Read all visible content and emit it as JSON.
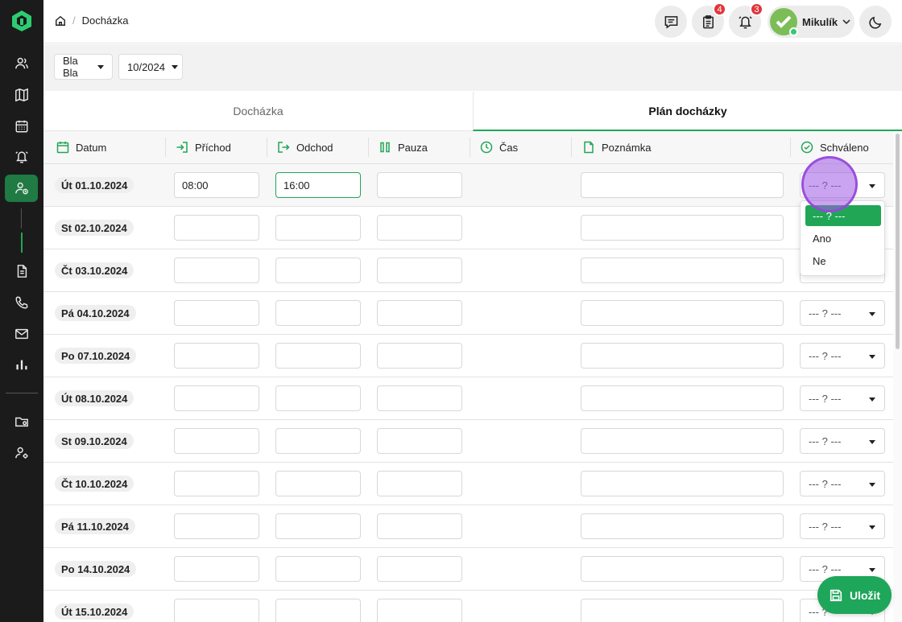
{
  "breadcrumb": {
    "current": "Docházka"
  },
  "topbar": {
    "notes_badge": "4",
    "alerts_badge": "3",
    "user_name": "Mikulík"
  },
  "filters": {
    "person": "Bla Bla",
    "period": "10/2024"
  },
  "tabs": [
    {
      "label": "Docházka",
      "active": false
    },
    {
      "label": "Plán docházky",
      "active": true
    }
  ],
  "columns": {
    "date": "Datum",
    "arrival": "Příchod",
    "departure": "Odchod",
    "pause": "Pauza",
    "time": "Čas",
    "note": "Poznámka",
    "approved": "Schváleno"
  },
  "rows": [
    {
      "date": "Út 01.10.2024",
      "arrival": "08:00",
      "departure": "16:00",
      "pause": "",
      "approved": "--- ? ---"
    },
    {
      "date": "St 02.10.2024",
      "arrival": "",
      "departure": "",
      "pause": "",
      "approved": "--- ? ---"
    },
    {
      "date": "Čt 03.10.2024",
      "arrival": "",
      "departure": "",
      "pause": "",
      "approved": "--- ? ---"
    },
    {
      "date": "Pá 04.10.2024",
      "arrival": "",
      "departure": "",
      "pause": "",
      "approved": "--- ? ---"
    },
    {
      "date": "Po 07.10.2024",
      "arrival": "",
      "departure": "",
      "pause": "",
      "approved": "--- ? ---"
    },
    {
      "date": "Út 08.10.2024",
      "arrival": "",
      "departure": "",
      "pause": "",
      "approved": "--- ? ---"
    },
    {
      "date": "St 09.10.2024",
      "arrival": "",
      "departure": "",
      "pause": "",
      "approved": "--- ? ---"
    },
    {
      "date": "Čt 10.10.2024",
      "arrival": "",
      "departure": "",
      "pause": "",
      "approved": "--- ? ---"
    },
    {
      "date": "Pá 11.10.2024",
      "arrival": "",
      "departure": "",
      "pause": "",
      "approved": "--- ? ---"
    },
    {
      "date": "Po 14.10.2024",
      "arrival": "",
      "departure": "",
      "pause": "",
      "approved": "--- ? ---"
    },
    {
      "date": "Út 15.10.2024",
      "arrival": "",
      "departure": "",
      "pause": "",
      "approved": "--- ? ---"
    }
  ],
  "approval_menu": {
    "options": [
      "--- ? ---",
      "Ano",
      "Ne"
    ],
    "selected": "--- ? ---"
  },
  "save_label": "Uložit",
  "colors": {
    "accent": "#21a656",
    "sidebar": "#1b1b1b",
    "badge": "#e0353b"
  }
}
